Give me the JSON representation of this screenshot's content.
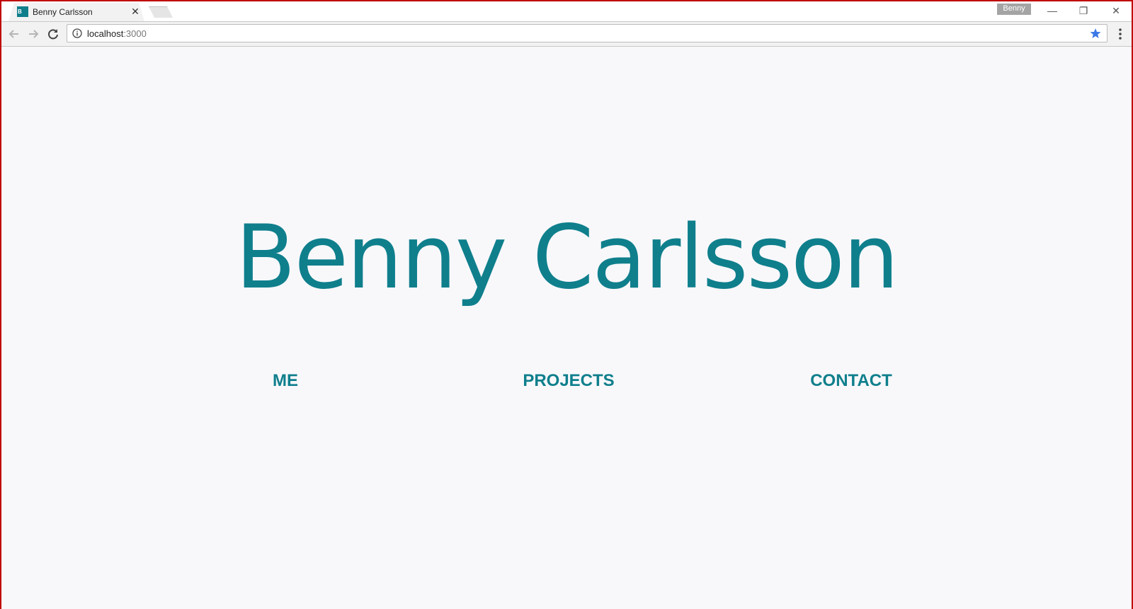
{
  "browser": {
    "tab": {
      "title": "Benny Carlsson",
      "favicon_text": "B",
      "close_glyph": "✕"
    },
    "profile_name": "Benny",
    "window_controls": {
      "minimize": "—",
      "restore": "❐",
      "close": "✕"
    },
    "address_bar": {
      "host": "localhost",
      "port": ":3000"
    },
    "icons": {
      "back": "back-arrow-icon",
      "forward": "forward-arrow-icon",
      "reload": "reload-icon",
      "site_info": "info-icon",
      "bookmark": "star-icon",
      "menu": "kebab-menu-icon"
    }
  },
  "page": {
    "title": "Benny Carlsson",
    "nav": [
      {
        "label": "ME"
      },
      {
        "label": "PROJECTS"
      },
      {
        "label": "CONTACT"
      }
    ]
  },
  "colors": {
    "accent": "#0f7f8c",
    "page_background": "#f8f8fb",
    "bookmark_star": "#3b78e7",
    "window_border": "#c00000"
  }
}
